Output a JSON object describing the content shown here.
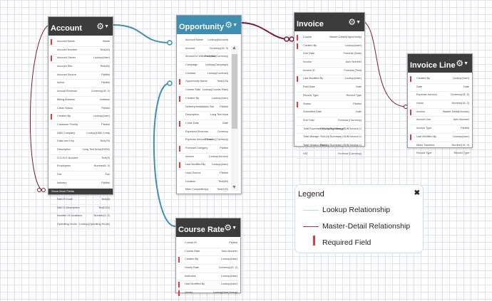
{
  "gear_icon": "gear-icon",
  "colors": {
    "lookup": "#3d8eb1",
    "master_detail": "#7a1a2e",
    "required": "#e23a3a",
    "header": "#3c3c3c",
    "header_selected": "#3d8eb1"
  },
  "objects": [
    {
      "key": "account",
      "title": "Account",
      "selected": false,
      "footer": "Show More Fields",
      "fields": [
        {
          "n": "Account Name",
          "t": "Name",
          "r": true
        },
        {
          "n": "Account Number",
          "t": "Text(40)",
          "r": false
        },
        {
          "n": "Account Owner",
          "t": "Lookup(User)",
          "r": true
        },
        {
          "n": "Account Site",
          "t": "Text(80)",
          "r": false
        },
        {
          "n": "Account Source",
          "t": "Picklist",
          "r": false
        },
        {
          "n": "Active",
          "t": "Picklist",
          "r": false
        },
        {
          "n": "Annual Revenue",
          "t": "Currency(18, 0)",
          "r": false
        },
        {
          "n": "Billing Address",
          "t": "Address",
          "r": false
        },
        {
          "n": "Clean Status",
          "t": "Picklist",
          "r": false
        },
        {
          "n": "Created By",
          "t": "Lookup(User)",
          "r": true
        },
        {
          "n": "Customer Priority",
          "t": "Picklist",
          "r": false
        },
        {
          "n": "D&B Company",
          "t": "Lookup(D&B Comp",
          "r": false
        },
        {
          "n": "Data.com Key",
          "t": "Text(20)",
          "r": false
        },
        {
          "n": "Description",
          "t": "Long Text Area(32000)",
          "r": false
        },
        {
          "n": "D-U-N-S Number",
          "t": "Text(9)",
          "r": false
        },
        {
          "n": "Employees",
          "t": "Number(8, 0)",
          "r": false
        },
        {
          "n": "Fax",
          "t": "Fax",
          "r": false
        },
        {
          "n": "Industry",
          "t": "Picklist",
          "r": false
        },
        {
          "n": "Last Modified By",
          "t": "Lookup(User)",
          "r": true
        },
        {
          "n": "NAICS Code",
          "t": "Text(8)",
          "r": false
        },
        {
          "n": "NAICS Description",
          "t": "Text(120)",
          "r": false
        },
        {
          "n": "Number of Locations",
          "t": "Number(3, 0)",
          "r": false
        },
        {
          "n": "Operating Hours",
          "t": "Lookup(Operating Hours)",
          "r": false
        }
      ]
    },
    {
      "key": "opportunity",
      "title": "Opportunity",
      "selected": true,
      "footer": "",
      "fields": [
        {
          "n": "Account Name",
          "t": "Lookup(Account)",
          "r": false
        },
        {
          "n": "Amount",
          "t": "Currency(16, 2)",
          "r": false
        },
        {
          "n": "Amount to Withdraw (Nat",
          "t": "Formula (Currency)",
          "r": false
        },
        {
          "n": "Campaign",
          "t": "Lookup(Campaign)",
          "r": false
        },
        {
          "n": "Contract",
          "t": "Lookup(Contract)",
          "r": false
        },
        {
          "n": "Opportunity Name",
          "t": "Text(120)",
          "r": true
        },
        {
          "n": "Course Rate",
          "t": "Lookup(Course Rate)",
          "r": false
        },
        {
          "n": "Created By",
          "t": "Lookup(User)",
          "r": true
        },
        {
          "n": "Delivery/Installation Sta",
          "t": "Picklist",
          "r": false
        },
        {
          "n": "Description",
          "t": "Long Text Area",
          "r": false
        },
        {
          "n": "Close Date",
          "t": "Date",
          "r": true
        },
        {
          "n": "Expected Revenue",
          "t": "Currency",
          "r": false
        },
        {
          "n": "Expense Amount Total",
          "t": "Formula (Currency)",
          "r": false
        },
        {
          "n": "Forecast Category",
          "t": "Picklist",
          "r": true
        },
        {
          "n": "Invoice",
          "t": "Lookup(Invoice)",
          "r": false
        },
        {
          "n": "Last Modified By",
          "t": "Lookup(User)",
          "r": true
        },
        {
          "n": "Lead Source",
          "t": "Picklist",
          "r": false
        },
        {
          "n": "Location",
          "t": "Text(80)",
          "r": false
        },
        {
          "n": "Main Competitor(s)",
          "t": "Text(100)",
          "r": false
        },
        {
          "n": "Next Step",
          "t": "Text(255)",
          "r": false
        },
        {
          "n": "Opportunity Owner",
          "t": "Lookup(User)",
          "r": true
        }
      ]
    },
    {
      "key": "invoice",
      "title": "Invoice",
      "selected": false,
      "footer": "",
      "fields": [
        {
          "n": "Course",
          "t": "Master-Detail(Opportunity)",
          "r": true
        },
        {
          "n": "Created By",
          "t": "Lookup(User)",
          "r": true
        },
        {
          "n": "Due Date",
          "t": "Formula (Date)",
          "r": false
        },
        {
          "n": "Invoice",
          "t": "Auto Number",
          "r": false
        },
        {
          "n": "Invoice ID",
          "t": "Formula (Text)",
          "r": false
        },
        {
          "n": "Last Modified By",
          "t": "Lookup(User)",
          "r": true
        },
        {
          "n": "Paid Date",
          "t": "Date",
          "r": false
        },
        {
          "n": "Record Type",
          "t": "Record Type",
          "r": false
        },
        {
          "n": "Status",
          "t": "Picklist",
          "r": true
        },
        {
          "n": "Submitted Date",
          "t": "Date",
          "r": false
        },
        {
          "n": "Sub Total",
          "t": "Formula (Currency)",
          "r": false
        },
        {
          "n": "Total Expenses Excluding Mileage",
          "t": "Roll-Up Summary (SUM Invoice Li",
          "r": false
        },
        {
          "n": "Total Mileage",
          "t": "Roll-Up Summary (SUM Invoice Li",
          "r": false
        },
        {
          "n": "Total Session Hours",
          "t": "Roll-Up Summary (SUM Invoice Li",
          "r": false
        },
        {
          "n": "VAT",
          "t": "Formula (Currency)",
          "r": false
        }
      ]
    },
    {
      "key": "invoice_line",
      "title": "Invoice Line",
      "selected": false,
      "footer": "",
      "fields": [
        {
          "n": "Created By",
          "t": "Lookup(User)",
          "r": true
        },
        {
          "n": "Date",
          "t": "Date",
          "r": false
        },
        {
          "n": "Expense Amount",
          "t": "Currency(18, 2)",
          "r": false
        },
        {
          "n": "Hours",
          "t": "Number(18, 2)",
          "r": false
        },
        {
          "n": "Invoice",
          "t": "Master-Detail(Invoice)",
          "r": true
        },
        {
          "n": "Invoice Line",
          "t": "Auto Number",
          "r": false
        },
        {
          "n": "Invoice Type",
          "t": "Picklist",
          "r": false
        },
        {
          "n": "Last Modified By",
          "t": "Lookup(User)",
          "r": true
        },
        {
          "n": "Miles Travelled",
          "t": "Number(18, 0)",
          "r": false
        },
        {
          "n": "Record Type",
          "t": "Record Type",
          "r": false
        }
      ]
    },
    {
      "key": "course_rate",
      "title": "Course Rate",
      "selected": false,
      "footer": "",
      "fields": [
        {
          "n": "Course ID",
          "t": "Picklist",
          "r": false
        },
        {
          "n": "Course Rate",
          "t": "Auto Number",
          "r": false
        },
        {
          "n": "Created By",
          "t": "Lookup(User)",
          "r": true
        },
        {
          "n": "Hourly Rate",
          "t": "Currency(16, 2)",
          "r": false
        },
        {
          "n": "Instructor",
          "t": "Lookup(User)",
          "r": false
        },
        {
          "n": "Last Modified By",
          "t": "Lookup(User)",
          "r": true
        },
        {
          "n": "Owner",
          "t": "Lookup(User,Group)",
          "r": true
        }
      ]
    }
  ],
  "legend": {
    "title": "Legend",
    "close": "✖",
    "items": [
      {
        "label": "Lookup Relationship",
        "kind": "lookup"
      },
      {
        "label": "Master-Detail Relationship",
        "kind": "master_detail"
      },
      {
        "label": "Required Field",
        "kind": "required"
      }
    ]
  }
}
